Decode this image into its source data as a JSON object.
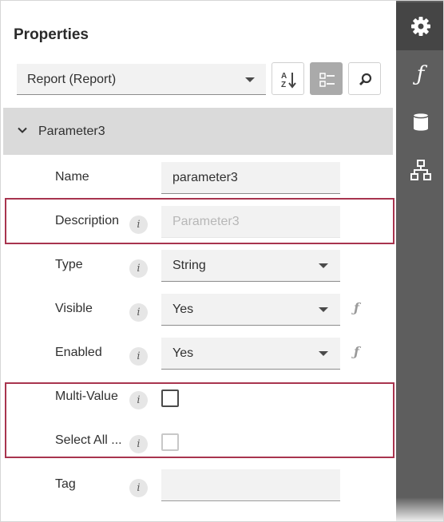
{
  "panel": {
    "title": "Properties",
    "object_selector": {
      "value": "Report (Report)"
    },
    "toolbar": {
      "sort_icon": "sort-alphabetical-icon",
      "categories_icon": "categories-icon",
      "search_icon": "search-icon"
    },
    "group": {
      "title": "Parameter3",
      "expanded": true
    },
    "properties": [
      {
        "label": "Name",
        "value": "parameter3",
        "has_info": false
      },
      {
        "label": "Description",
        "placeholder": "Parameter3",
        "has_info": true,
        "disabled": true
      },
      {
        "label": "Type",
        "value": "String",
        "has_info": true,
        "dropdown": true
      },
      {
        "label": "Visible",
        "value": "Yes",
        "has_info": true,
        "dropdown": true,
        "expression": "ƒ"
      },
      {
        "label": "Enabled",
        "value": "Yes",
        "has_info": true,
        "dropdown": true,
        "expression": "ƒ"
      },
      {
        "label": "Multi-Value",
        "checked": false,
        "has_info": true
      },
      {
        "label": "Select All ...",
        "checked": false,
        "has_info": true,
        "disabled": true
      },
      {
        "label": "Tag",
        "value": "",
        "has_info": true
      }
    ],
    "info_glyph": "i"
  },
  "tabs": [
    {
      "name": "properties",
      "icon": "gear-icon",
      "active": true
    },
    {
      "name": "expressions",
      "icon": "function-icon",
      "glyph": "ƒ",
      "active": false
    },
    {
      "name": "data-source",
      "icon": "database-icon",
      "active": false
    },
    {
      "name": "report-explorer",
      "icon": "hierarchy-icon",
      "active": false
    }
  ],
  "colors": {
    "highlight": "#a8344e",
    "tabbar": "#5e5e5e",
    "tab_active": "#454545",
    "group_header": "#dadada",
    "field_bg": "#f2f2f2"
  }
}
